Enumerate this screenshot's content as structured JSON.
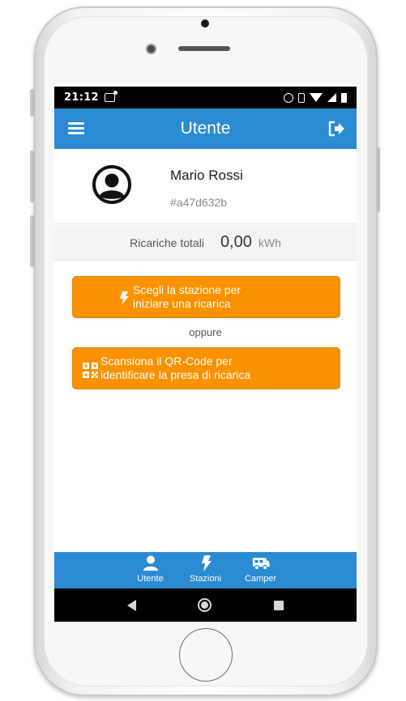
{
  "status_bar": {
    "time": "21:12",
    "icons": [
      "gallery-icon",
      "alarm-icon",
      "vibrate-icon",
      "wifi-icon",
      "signal-icon",
      "battery-icon"
    ]
  },
  "app_bar": {
    "title": "Utente",
    "menu_icon": "menu-icon",
    "logout_icon": "logout-icon"
  },
  "profile": {
    "name": "Mario Rossi",
    "id": "#a47d632b",
    "avatar_icon": "user-circle-icon"
  },
  "totals": {
    "label": "Ricariche totali",
    "value": "0,00",
    "unit": "kWh"
  },
  "actions": {
    "station_line1": "Scegli la stazione per",
    "station_line2": "iniziare una ricarica",
    "station_icon": "bolt-icon",
    "or": "oppure",
    "qr_line1": "Scansiona il QR-Code per",
    "qr_line2": "identificare la presa di ricarica",
    "qr_icon": "qrcode-icon"
  },
  "bottom_nav": {
    "items": [
      {
        "label": "Utente",
        "icon": "user-icon"
      },
      {
        "label": "Stazioni",
        "icon": "bolt-icon"
      },
      {
        "label": "Camper",
        "icon": "camper-icon"
      }
    ]
  },
  "colors": {
    "primary": "#2a8bd3",
    "accent": "#fa9100",
    "status_bar": "#000000"
  }
}
